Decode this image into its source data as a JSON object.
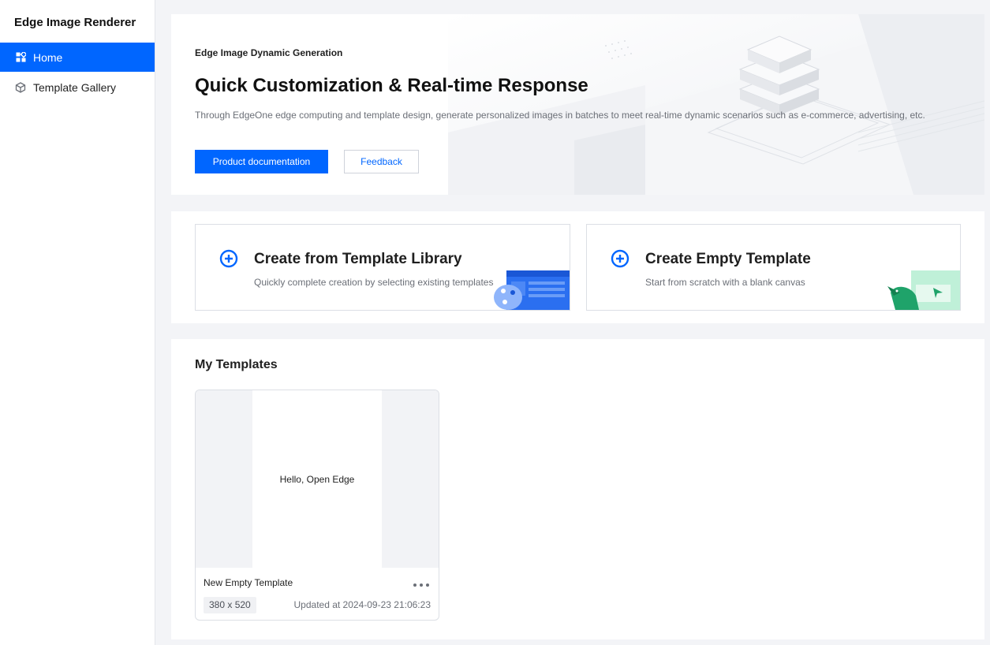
{
  "app": {
    "title": "Edge Image Renderer"
  },
  "sidebar": {
    "items": [
      {
        "label": "Home",
        "icon": "dashboard-icon",
        "active": true
      },
      {
        "label": "Template Gallery",
        "icon": "cube-icon",
        "active": false
      }
    ]
  },
  "hero": {
    "eyebrow": "Edge Image Dynamic Generation",
    "title": "Quick Customization & Real-time Response",
    "description": "Through EdgeOne edge computing and template design, generate personalized images in batches to meet real-time dynamic scenarios such as e-commerce, advertising, etc.",
    "primary_button": "Product documentation",
    "secondary_button": "Feedback"
  },
  "create": {
    "cards": [
      {
        "title": "Create from Template Library",
        "subtitle": "Quickly complete creation by selecting existing templates",
        "icon": "plus-circle-icon"
      },
      {
        "title": "Create Empty Template",
        "subtitle": "Start from scratch with a blank canvas",
        "icon": "plus-circle-icon"
      }
    ]
  },
  "my_templates": {
    "title": "My Templates",
    "items": [
      {
        "preview_text": "Hello, Open Edge",
        "name": "New Empty Template",
        "size": "380 x 520",
        "updated": "Updated at 2024-09-23 21:06:23"
      }
    ]
  },
  "colors": {
    "accent": "#0066ff",
    "background": "#f3f4f7",
    "card_border": "#dcdfe5"
  }
}
